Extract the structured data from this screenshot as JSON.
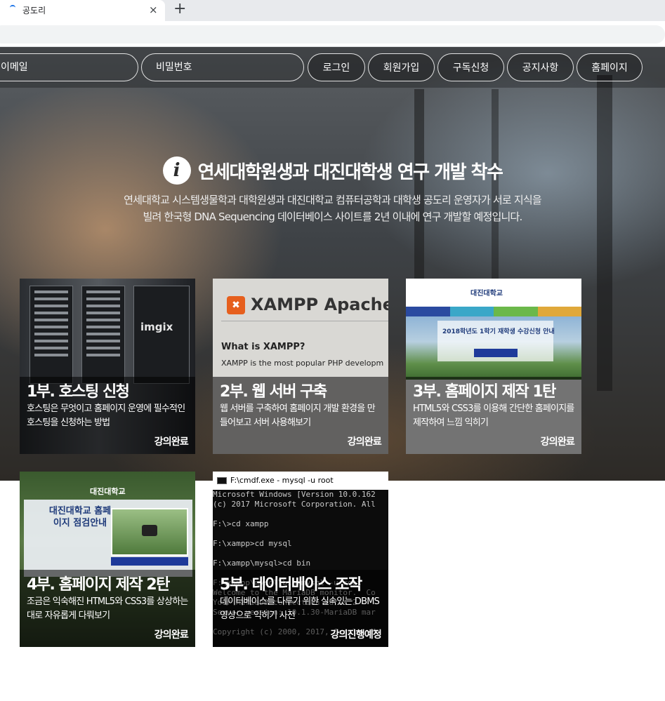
{
  "browser": {
    "tab_title": "공도리",
    "tab_close": "×",
    "new_tab": "+"
  },
  "login": {
    "email_placeholder": "이메일",
    "password_placeholder": "비밀번호",
    "buttons": [
      "로그인",
      "회원가입",
      "구독신청",
      "공지사항",
      "홈페이지"
    ]
  },
  "notice": {
    "icon": "i",
    "title": "연세대학원생과 대진대학생 연구 개발 착수",
    "line1": "연세대학교 시스템생물학과 대학원생과 대진대학교 컴퓨터공학과 대학생 공도리 운영자가 서로 지식을",
    "line2": "빌려 한국형 DNA Sequencing 데이터베이스 사이트를 2년 이내에 연구 개발할 예정입니다."
  },
  "cards": [
    {
      "title": "1부. 호스팅 신청",
      "desc": "호스팅은 무엇이고 홈페이지 운영에 필수적인 호스팅을 신청하는 방법",
      "status": "강의완료",
      "image_text": "imgix"
    },
    {
      "title": "2부. 웹 서버 구축",
      "desc": "웹 서버를 구축하여 홈페이지 개발 환경을 만들어보고 서버 사용해보기",
      "status": "강의완료",
      "image_title": "XAMPP Apache",
      "image_q": "What is XAMPP?",
      "image_p": "XAMPP is the most popular PHP developm"
    },
    {
      "title": "3부. 홈페이지 제작 1탄",
      "desc": "HTML5와 CSS3를 이용해 간단한 홈페이지를 제작하여 느낌 익히기",
      "status": "강의완료",
      "image_logo": "대진대학교",
      "image_title": "2018학년도 1학기 재학생 수강신청 안내"
    },
    {
      "title": "4부. 홈페이지 제작 2탄",
      "desc": "조금은 익숙해진 HTML5와 CSS3를 상상하는대로 자유롭게 다뤄보기",
      "status": "강의완료",
      "image_header": "대진대학교",
      "image_title": "대진대학교 홈페이지 점검안내"
    },
    {
      "title": "5부. 데이터베이스 조작",
      "desc": "데이터베이스를 다루기 위한 실속있는 DBMS 영상으로 익히기 사전",
      "status": "강의진행예정",
      "console_title": "F:\\cmdf.exe - mysql  -u root",
      "console": "Microsoft Windows [Version 10.0.162\n(c) 2017 Microsoft Corporation. All\n\nF:\\>cd xampp\n\nF:\\xampp>cd mysql\n\nF:\\xampp\\mysql>cd bin\n\nF:\\xampp\\mysql\\bin>mysql -u root\nWelcome to the MariaDB monitor.  Co\nYour MariaDB connection id is 2\nServer version: 10.1.30-MariaDB mar\n\nCopyright (c) 2000, 2017, Oracle, M"
    }
  ],
  "colors": {
    "overlay": "rgba(0,0,0,0.55)",
    "brand_blue": "#1e3a7a",
    "xampp_orange": "#e65f1d"
  },
  "icons": {
    "tab": "loading-spinner-icon",
    "notice": "info-icon"
  }
}
